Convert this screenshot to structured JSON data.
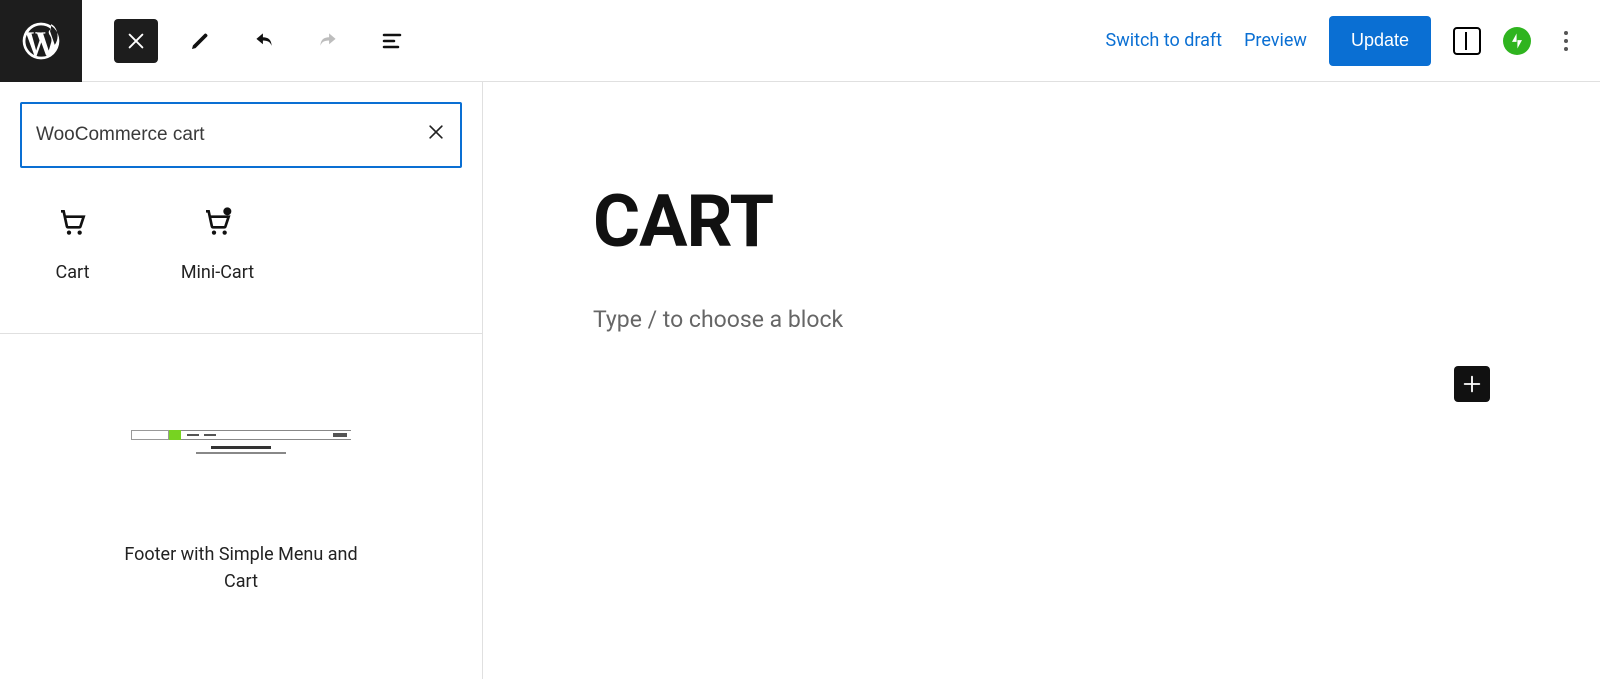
{
  "topbar": {
    "switch_draft": "Switch to draft",
    "preview": "Preview",
    "update": "Update"
  },
  "inserter": {
    "search_value": "WooCommerce cart",
    "blocks": [
      {
        "label": "Cart"
      },
      {
        "label": "Mini-Cart"
      }
    ],
    "pattern_label": "Footer with Simple Menu and Cart"
  },
  "canvas": {
    "title": "CART",
    "placeholder": "Type / to choose a block"
  }
}
